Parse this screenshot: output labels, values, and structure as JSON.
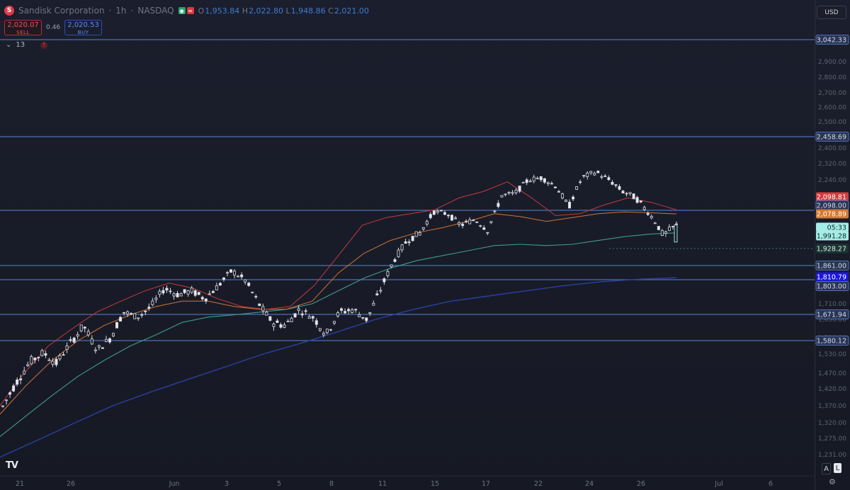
{
  "header": {
    "logo_letter": "S",
    "symbol": "Sandisk Corporation",
    "interval": "1h",
    "exchange": "NASDAQ",
    "ohlc": {
      "o_label": "O",
      "o": "1,953.84",
      "h_label": "H",
      "h": "2,022.80",
      "l_label": "L",
      "l": "1,948.86",
      "c_label": "C",
      "c": "2,021.00"
    }
  },
  "trade": {
    "sell_price": "2,020.07",
    "sell_label": "SELL",
    "spread": "0.46",
    "buy_price": "2,020.53",
    "buy_label": "BUY"
  },
  "indicator": {
    "label": "13"
  },
  "currency": "USD",
  "axis_buttons": {
    "auto": "A",
    "log": "L"
  },
  "colors": {
    "up": "#c9ccd6",
    "down": "#e7e9ef",
    "ema_fast": "#c43a3f",
    "ema_mid": "#d27434",
    "ema_slow": "#3f9a90",
    "ema_long": "#2b3fa0",
    "hline": "#4d6fb6"
  },
  "chart_data": {
    "type": "candlestick",
    "y_range": [
      1200,
      3080
    ],
    "x_ticks": [
      "21",
      "26",
      "Jun",
      "3",
      "5",
      "8",
      "11",
      "15",
      "17",
      "22",
      "24",
      "26",
      "Jul",
      "6"
    ],
    "y_ticks": [
      "2,900.00",
      "2,800.00",
      "2,700.00",
      "2,600.00",
      "2,500.00",
      "2,400.00",
      "2,320.00",
      "2,240.00",
      "2,160.00",
      "2,020.00",
      "1,860.00",
      "1,780.00",
      "1,710.00",
      "1,650.00",
      "1,590.00",
      "1,530.00",
      "1,470.00",
      "1,420.00",
      "1,370.00",
      "1,320.00",
      "1,275.00",
      "1,231.00"
    ],
    "horizontal_levels": [
      3042.33,
      2458.69,
      2098.0,
      1861.0,
      1803.0,
      1671.94,
      1580.12
    ],
    "price_tags": [
      {
        "label": "3,042.33",
        "style": "line"
      },
      {
        "label": "2,458.69",
        "style": "line"
      },
      {
        "label": "2,098.81",
        "style": "fast"
      },
      {
        "label": "2,098.00",
        "style": "line"
      },
      {
        "label": "2,078.89",
        "style": "mid"
      },
      {
        "label": "05:33",
        "style": "last"
      },
      {
        "label": "1,991.28",
        "style": "last"
      },
      {
        "label": "1,928.27",
        "style": "slow"
      },
      {
        "label": "1,861.00",
        "style": "line"
      },
      {
        "label": "1,810.79",
        "style": "long"
      },
      {
        "label": "1,803.00",
        "style": "line"
      },
      {
        "label": "1,671.94",
        "style": "line"
      },
      {
        "label": "1,580.12",
        "style": "line"
      }
    ],
    "ohlc_anchor": [
      [
        1352,
        1380,
        1340,
        1368
      ],
      [
        1368,
        1448,
        1360,
        1440
      ],
      [
        1440,
        1520,
        1430,
        1505
      ],
      [
        1505,
        1540,
        1495,
        1535
      ],
      [
        1535,
        1545,
        1490,
        1500
      ],
      [
        1500,
        1575,
        1495,
        1570
      ],
      [
        1570,
        1640,
        1555,
        1630
      ],
      [
        1630,
        1650,
        1540,
        1545
      ],
      [
        1545,
        1600,
        1530,
        1590
      ],
      [
        1590,
        1690,
        1580,
        1680
      ],
      [
        1680,
        1700,
        1650,
        1660
      ],
      [
        1660,
        1720,
        1640,
        1700
      ],
      [
        1700,
        1780,
        1690,
        1770
      ],
      [
        1770,
        1785,
        1735,
        1745
      ],
      [
        1745,
        1770,
        1720,
        1760
      ],
      [
        1760,
        1790,
        1720,
        1730
      ],
      [
        1730,
        1790,
        1720,
        1780
      ],
      [
        1780,
        1870,
        1775,
        1840
      ],
      [
        1840,
        1880,
        1790,
        1800
      ],
      [
        1800,
        1830,
        1700,
        1710
      ],
      [
        1710,
        1720,
        1610,
        1640
      ],
      [
        1640,
        1660,
        1600,
        1630
      ],
      [
        1630,
        1700,
        1620,
        1690
      ],
      [
        1690,
        1700,
        1640,
        1660
      ],
      [
        1660,
        1740,
        1530,
        1600
      ],
      [
        1600,
        1700,
        1590,
        1680
      ],
      [
        1680,
        1780,
        1650,
        1690
      ],
      [
        1690,
        1700,
        1640,
        1650
      ],
      [
        1650,
        1780,
        1640,
        1760
      ],
      [
        1760,
        1900,
        1750,
        1880
      ],
      [
        1880,
        1970,
        1870,
        1960
      ],
      [
        1960,
        2010,
        1940,
        1990
      ],
      [
        1990,
        2100,
        1980,
        2090
      ],
      [
        2090,
        2130,
        2060,
        2080
      ],
      [
        2080,
        2100,
        2010,
        2020
      ],
      [
        2020,
        2060,
        1990,
        2050
      ],
      [
        2050,
        2070,
        1980,
        2000
      ],
      [
        2000,
        2170,
        1990,
        2160
      ],
      [
        2160,
        2180,
        2150,
        2170
      ],
      [
        2170,
        2240,
        2160,
        2240
      ],
      [
        2240,
        2280,
        2230,
        2250
      ],
      [
        2250,
        2260,
        2200,
        2210
      ],
      [
        2210,
        2230,
        2100,
        2110
      ],
      [
        2110,
        2260,
        2100,
        2250
      ],
      [
        2250,
        2290,
        2190,
        2280
      ],
      [
        2280,
        2300,
        2230,
        2240
      ],
      [
        2240,
        2250,
        2170,
        2180
      ],
      [
        2180,
        2200,
        2130,
        2150
      ],
      [
        2150,
        2170,
        2060,
        2080
      ],
      [
        2080,
        2100,
        1930,
        1980
      ],
      [
        1980,
        2040,
        1960,
        2021
      ]
    ],
    "ema_fast_anchor": [
      1370,
      1470,
      1560,
      1620,
      1680,
      1720,
      1760,
      1790,
      1770,
      1730,
      1700,
      1690,
      1700,
      1780,
      1900,
      2020,
      2060,
      2080,
      2100,
      2150,
      2180,
      2230,
      2150,
      2070,
      2080,
      2120,
      2150,
      2130,
      2100
    ],
    "ema_mid_anchor": [
      1345,
      1430,
      1510,
      1580,
      1630,
      1670,
      1700,
      1720,
      1720,
      1700,
      1690,
      1690,
      1720,
      1830,
      1910,
      1960,
      1990,
      2010,
      2040,
      2080,
      2065,
      2040,
      2060,
      2080,
      2090,
      2085,
      2079
    ],
    "ema_slow_anchor": [
      1280,
      1340,
      1400,
      1460,
      1510,
      1560,
      1600,
      1640,
      1660,
      1670,
      1680,
      1690,
      1710,
      1760,
      1810,
      1850,
      1880,
      1900,
      1920,
      1940,
      1945,
      1940,
      1945,
      1960,
      1975,
      1985,
      1990
    ],
    "ema_long_anchor": [
      1225,
      1270,
      1320,
      1370,
      1410,
      1450,
      1490,
      1530,
      1570,
      1610,
      1650,
      1690,
      1720,
      1740,
      1760,
      1780,
      1795,
      1805,
      1811
    ]
  }
}
